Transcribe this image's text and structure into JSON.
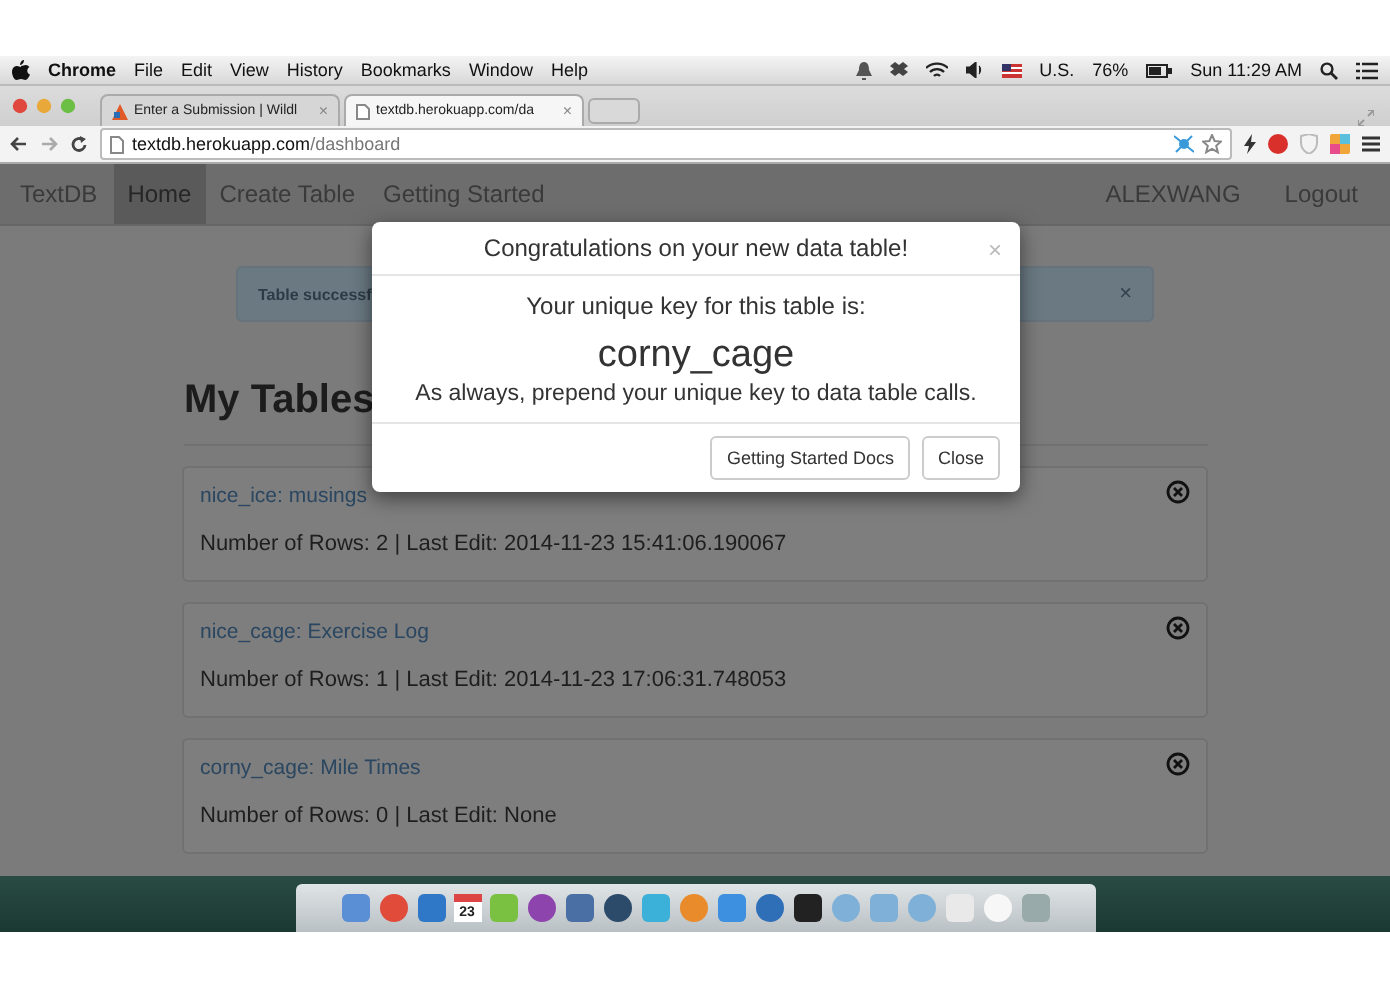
{
  "menu_bar": {
    "app": "Chrome",
    "menus": [
      "File",
      "Edit",
      "View",
      "History",
      "Bookmarks",
      "Window",
      "Help"
    ],
    "input_source": "U.S.",
    "battery": "76%",
    "clock": "Sun 11:29 AM"
  },
  "browser": {
    "tabs": [
      {
        "title": "Enter a Submission | Wildl",
        "close": "×",
        "selected": false
      },
      {
        "title": "textdb.herokuapp.com/da",
        "close": "×",
        "selected": true
      }
    ],
    "url_host": "textdb.herokuapp.com",
    "url_path": "/dashboard"
  },
  "navbar": {
    "brand": "TextDB",
    "items": [
      {
        "label": "Home",
        "selected": true
      },
      {
        "label": "Create Table",
        "selected": false
      },
      {
        "label": "Getting Started",
        "selected": false
      }
    ],
    "user": "ALEXWANG",
    "logout": "Logout"
  },
  "alert": {
    "text": "Table successf",
    "close": "×"
  },
  "heading": "My Tables",
  "tables": [
    {
      "title": "nice_ice: musings",
      "info": "Number of Rows: 2 | Last Edit: 2014-11-23 15:41:06.190067"
    },
    {
      "title": "nice_cage: Exercise Log",
      "info": "Number of Rows: 1 | Last Edit: 2014-11-23 17:06:31.748053"
    },
    {
      "title": "corny_cage: Mile Times",
      "info": "Number of Rows: 0 | Last Edit: None"
    }
  ],
  "modal": {
    "title": "Congratulations on your new data table!",
    "close": "×",
    "intro": "Your unique key for this table is:",
    "key": "corny_cage",
    "note": "As always, prepend your unique key to data table calls.",
    "buttons": [
      "Getting Started Docs",
      "Close"
    ]
  },
  "dock": {
    "calendar_day": "23"
  }
}
